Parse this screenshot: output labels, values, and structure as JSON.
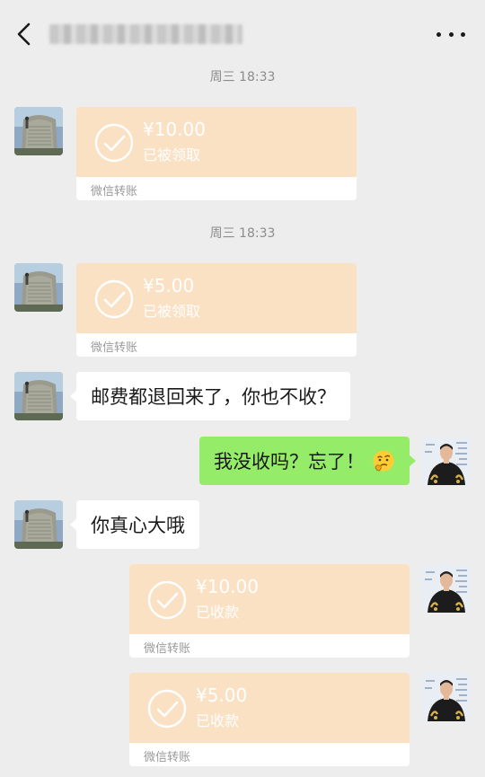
{
  "header": {
    "back_icon": "chevron-left-icon",
    "title": "",
    "more_icon": "more-dots-icon"
  },
  "messages": [
    {
      "kind": "timestamp",
      "text": "周三 18:33"
    },
    {
      "kind": "transfer",
      "side": "in",
      "amount": "¥10.00",
      "status": "已被领取",
      "label": "微信转账"
    },
    {
      "kind": "timestamp",
      "text": "周三 18:33"
    },
    {
      "kind": "transfer",
      "side": "in",
      "amount": "¥5.00",
      "status": "已被领取",
      "label": "微信转账"
    },
    {
      "kind": "text",
      "side": "in",
      "text": "邮费都退回来了，你也不收？"
    },
    {
      "kind": "text",
      "side": "out",
      "text": "我没收吗？忘了！",
      "emoji": "thinking-face-icon"
    },
    {
      "kind": "text",
      "side": "in",
      "text": "你真心大哦"
    },
    {
      "kind": "transfer",
      "side": "out",
      "amount": "¥10.00",
      "status": "已收款",
      "label": "微信转账"
    },
    {
      "kind": "transfer",
      "side": "out",
      "amount": "¥5.00",
      "status": "已收款",
      "label": "微信转账"
    }
  ],
  "colors": {
    "background": "#ededed",
    "transfer_card": "#fbe1c4",
    "outgoing_bubble": "#95ec69",
    "incoming_bubble": "#ffffff"
  }
}
